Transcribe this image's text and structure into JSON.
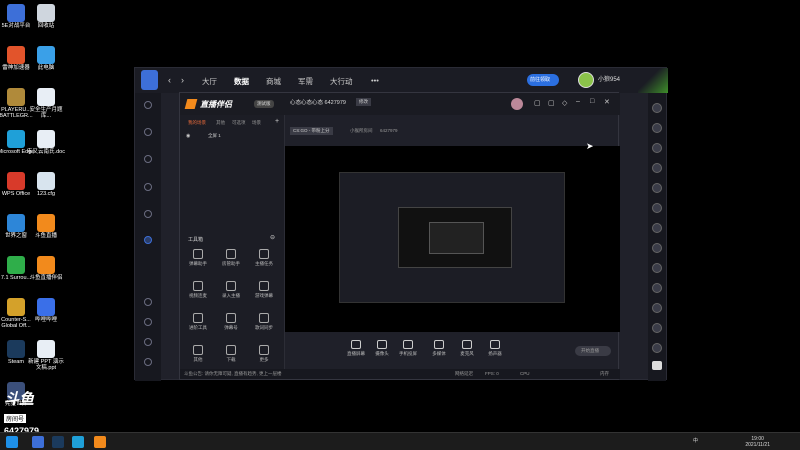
{
  "desktop_icons": [
    {
      "label": "5E对战平台",
      "color": "#3d6fd8",
      "icon": "5e-icon"
    },
    {
      "label": "回收站",
      "color": "#cfd6de",
      "icon": "recycle-bin-icon"
    },
    {
      "label": "雷神加速器",
      "color": "#e2542b",
      "icon": "leishen-icon"
    },
    {
      "label": "此电脑",
      "color": "#3aa0e8",
      "icon": "computer-icon"
    },
    {
      "label": "PLAYERU... BATTLEGR...",
      "color": "#b08a3a",
      "icon": "pubg-icon"
    },
    {
      "label": "安全生产月题库...",
      "color": "#e8eef5",
      "icon": "doc-icon"
    },
    {
      "label": "Microsoft Edge",
      "color": "#1fa0d8",
      "icon": "edge-icon"
    },
    {
      "label": "韦又云南氏.doc",
      "color": "#e8eef5",
      "icon": "doc-icon"
    },
    {
      "label": "WPS Office",
      "color": "#d83a2a",
      "icon": "wps-icon"
    },
    {
      "label": "123.cfg",
      "color": "#d8e4ee",
      "icon": "cfg-icon"
    },
    {
      "label": "世界之窗",
      "color": "#2d86d8",
      "icon": "browser-icon"
    },
    {
      "label": "斗鱼直播",
      "color": "#f28a1c",
      "icon": "douyu-icon"
    },
    {
      "label": "7.1 Surrou...",
      "color": "#2fae4a",
      "icon": "audio-icon"
    },
    {
      "label": "斗鱼直播伴侣",
      "color": "#f28a1c",
      "icon": "douyu-icon"
    },
    {
      "label": "Counter-S... Global Off...",
      "color": "#d4a12a",
      "icon": "csgo-icon"
    },
    {
      "label": "哔哩哔哩",
      "color": "#3a6fe8",
      "icon": "bilibili-icon"
    },
    {
      "label": "Steam",
      "color": "#1b3a5c",
      "icon": "steam-icon"
    },
    {
      "label": "新建 PPT 演示文稿.ppt",
      "color": "#e8eef5",
      "icon": "ppt-icon"
    },
    {
      "label": "完美世界",
      "color": "#3b4f7a",
      "icon": "game-icon"
    }
  ],
  "douyu_watermark": {
    "brand": "斗鱼",
    "sub": "房间号",
    "room": "6427979"
  },
  "win5e": {
    "tabs": [
      "大厅",
      "数据",
      "商城",
      "军需",
      "大行动"
    ],
    "more": "•••",
    "username": "小狼954",
    "promo": "前往领取"
  },
  "obs": {
    "brand": "直播伴侣",
    "version": "测试版",
    "scene_tabs": [
      "我的场景",
      "其他",
      "可选项",
      "场景"
    ],
    "scene_item": "全屏 1",
    "room_title": "心态心态心态 6427979",
    "room_btn": "修改",
    "game": "CS:GO - 带粉上分",
    "room_label": "小猴所房间",
    "room_id": "6427979",
    "tools_title": "工具箱",
    "tools": [
      "弹幕助手",
      "房管助手",
      "主播任务",
      "视频连麦",
      "录入主播",
      "游戏弹幕",
      "进阶工具",
      "弹幕号",
      "歌词同步",
      "其他",
      "下载",
      "更多"
    ],
    "controls": [
      "直播屏幕",
      "摄像头",
      "手机投屏",
      "多媒体",
      "麦克风",
      "扬声器"
    ],
    "start_btn": "开始直播",
    "status_notice": "斗鱼公告: 请你无障可疑, 直播有趋势, 更上一层楼",
    "status_right": [
      "网络延迟",
      "FPS: 0",
      "CPU",
      "内存"
    ]
  },
  "tray": {
    "time": "19:00",
    "date": "2021/11/21",
    "lang": "中"
  }
}
